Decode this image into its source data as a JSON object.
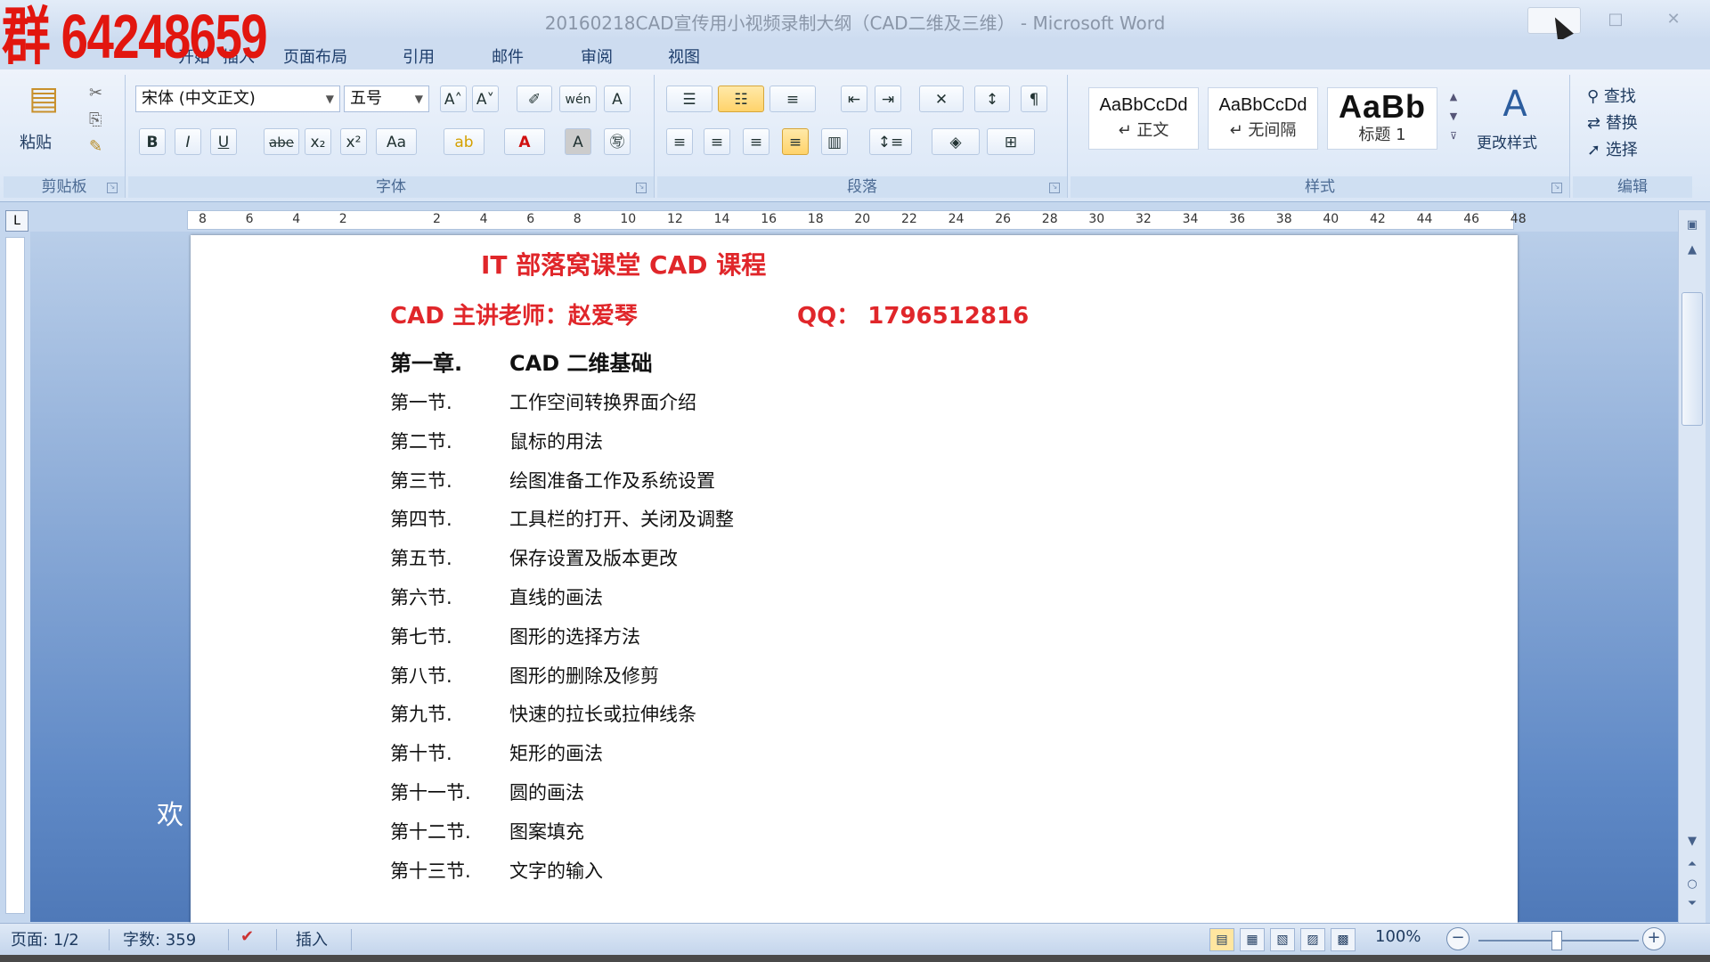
{
  "window": {
    "title": "20160218CAD宣传用小视频录制大纲（CAD二维及三维） - Microsoft Word",
    "overlay_number": "群 64248659",
    "min_glyph": "",
    "max_glyph": "□",
    "close_glyph": "✕"
  },
  "tabs": [
    "开始",
    "插入",
    "页面布局",
    "引用",
    "邮件",
    "审阅",
    "视图"
  ],
  "ribbon": {
    "clipboard": {
      "paste_label": "粘贴",
      "group_label": "剪贴板"
    },
    "font": {
      "font_name": "宋体 (中文正文)",
      "font_size": "五号",
      "group_label": "字体",
      "bold": "B",
      "italic": "I",
      "underline": "U",
      "strike": "abe",
      "subscript": "x₂",
      "superscript": "x²",
      "change_case": "Aa",
      "grow": "A˄",
      "shrink": "A˅",
      "clear": "A",
      "phonetic": "wén"
    },
    "paragraph": {
      "group_label": "段落"
    },
    "styles": {
      "group_label": "样式",
      "items": [
        {
          "sample": "AaBbCcDd",
          "name": "↵ 正文"
        },
        {
          "sample": "AaBbCcDd",
          "name": "↵ 无间隔"
        },
        {
          "sample": "AaBb",
          "name": "标题 1"
        }
      ],
      "change_styles": "更改样式"
    },
    "editing": {
      "group_label": "编辑",
      "find": "查找",
      "replace": "替换",
      "select": "选择"
    }
  },
  "ruler": {
    "corner": "L",
    "ticks": [
      "8",
      "6",
      "4",
      "2",
      "",
      "2",
      "4",
      "6",
      "8",
      "10",
      "12",
      "14",
      "16",
      "18",
      "20",
      "22",
      "24",
      "26",
      "28",
      "30",
      "32",
      "34",
      "36",
      "38",
      "40",
      "42",
      "44",
      "46",
      "48"
    ]
  },
  "document": {
    "title": "IT 部落窝课堂 CAD 课程",
    "subtitle": "CAD 主讲老师：赵爱琴",
    "qq": "QQ： 1796512816",
    "chapter_num": "第一章.",
    "chapter_title": "CAD 二维基础",
    "sections": [
      {
        "num": "第一节.",
        "title": "工作空间转换界面介绍"
      },
      {
        "num": "第二节.",
        "title": "鼠标的用法"
      },
      {
        "num": "第三节.",
        "title": "绘图准备工作及系统设置"
      },
      {
        "num": "第四节.",
        "title": "工具栏的打开、关闭及调整"
      },
      {
        "num": "第五节.",
        "title": "保存设置及版本更改"
      },
      {
        "num": "第六节.",
        "title": "直线的画法"
      },
      {
        "num": "第七节.",
        "title": "图形的选择方法"
      },
      {
        "num": "第八节.",
        "title": "图形的删除及修剪"
      },
      {
        "num": "第九节.",
        "title": "快速的拉长或拉伸线条"
      },
      {
        "num": "第十节.",
        "title": "矩形的画法"
      },
      {
        "num": "第十一节.",
        "title": "圆的画法"
      },
      {
        "num": "第十二节.",
        "title": "图案填充"
      },
      {
        "num": "第十三节.",
        "title": "文字的输入"
      }
    ],
    "side_text": "欢"
  },
  "status": {
    "page": "页面: 1/2",
    "word_count": "字数: 359",
    "mode": "插入",
    "zoom": "100%",
    "zoom_minus": "−",
    "zoom_plus": "+"
  },
  "colors": {
    "accent_red": "#e0262a",
    "ribbon_blue": "#d9e6f6"
  }
}
